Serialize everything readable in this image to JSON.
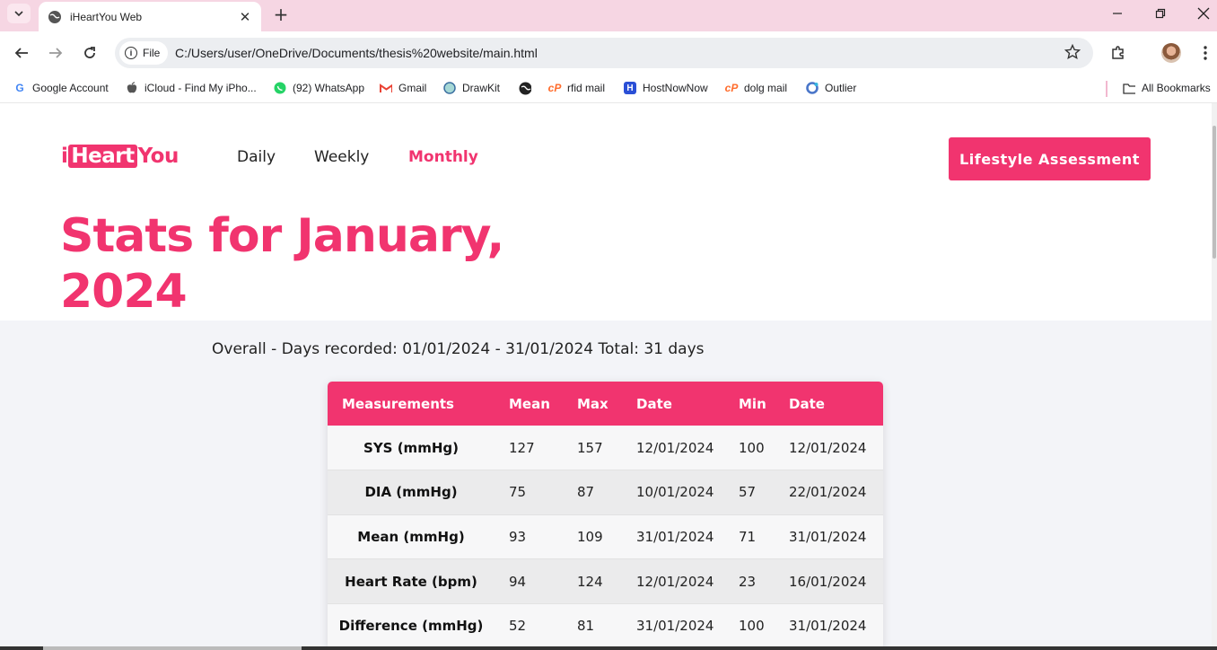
{
  "browser": {
    "tab_title": "iHeartYou Web",
    "url": "C:/Users/user/OneDrive/Documents/thesis%20website/main.html",
    "security_chip": "File",
    "bookmarks": [
      {
        "label": "Google Account",
        "icon": "google-icon"
      },
      {
        "label": "iCloud - Find My iPho...",
        "icon": "apple-icon"
      },
      {
        "label": "(92) WhatsApp",
        "icon": "whatsapp-icon"
      },
      {
        "label": "Gmail",
        "icon": "gmail-icon"
      },
      {
        "label": "DrawKit",
        "icon": "drawkit-icon"
      },
      {
        "label": "",
        "icon": "globe-icon"
      },
      {
        "label": "rfid mail",
        "icon": "cpanel-icon"
      },
      {
        "label": "HostNowNow",
        "icon": "hostnownow-icon"
      },
      {
        "label": "dolg mail",
        "icon": "cpanel-icon"
      },
      {
        "label": "Outlier",
        "icon": "outlier-icon"
      }
    ],
    "all_bookmarks": "All Bookmarks"
  },
  "site": {
    "logo_pre": "i",
    "logo_box": "Heart",
    "logo_post": "You",
    "nav": [
      "Daily",
      "Weekly",
      "Monthly"
    ],
    "active_nav": "Monthly",
    "cta": "Lifestyle Assessment",
    "brand_color": "#f1346f"
  },
  "stats": {
    "headline": "Stats for January, 2024",
    "summary": "Overall - Days recorded: 01/01/2024 - 31/01/2024 Total: 31 days",
    "columns": [
      "Measurements",
      "Mean",
      "Max",
      "Date",
      "Min",
      "Date"
    ],
    "rows": [
      [
        "SYS (mmHg)",
        "127",
        "157",
        "12/01/2024",
        "100",
        "12/01/2024"
      ],
      [
        "DIA (mmHg)",
        "75",
        "87",
        "10/01/2024",
        "57",
        "22/01/2024"
      ],
      [
        "Mean (mmHg)",
        "93",
        "109",
        "31/01/2024",
        "71",
        "31/01/2024"
      ],
      [
        "Heart Rate (bpm)",
        "94",
        "124",
        "12/01/2024",
        "23",
        "16/01/2024"
      ],
      [
        "Difference (mmHg)",
        "52",
        "81",
        "31/01/2024",
        "100",
        "31/01/2024"
      ]
    ]
  }
}
